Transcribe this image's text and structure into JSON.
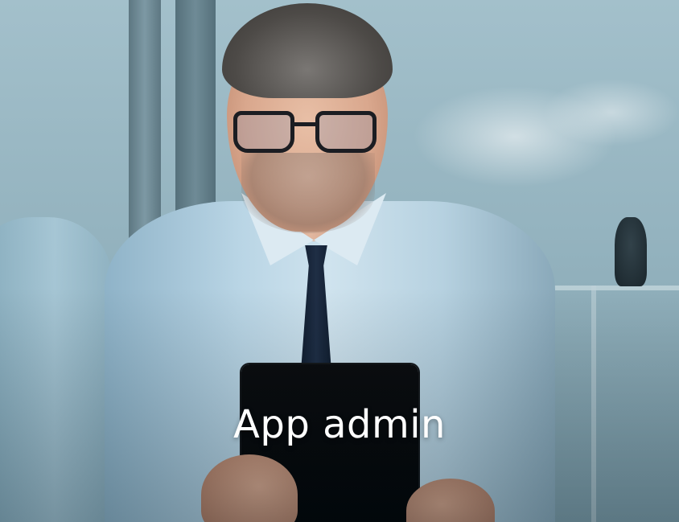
{
  "hero": {
    "title": "App admin",
    "title_color": "#ffffff"
  },
  "image": {
    "icon": "photo-icon"
  }
}
